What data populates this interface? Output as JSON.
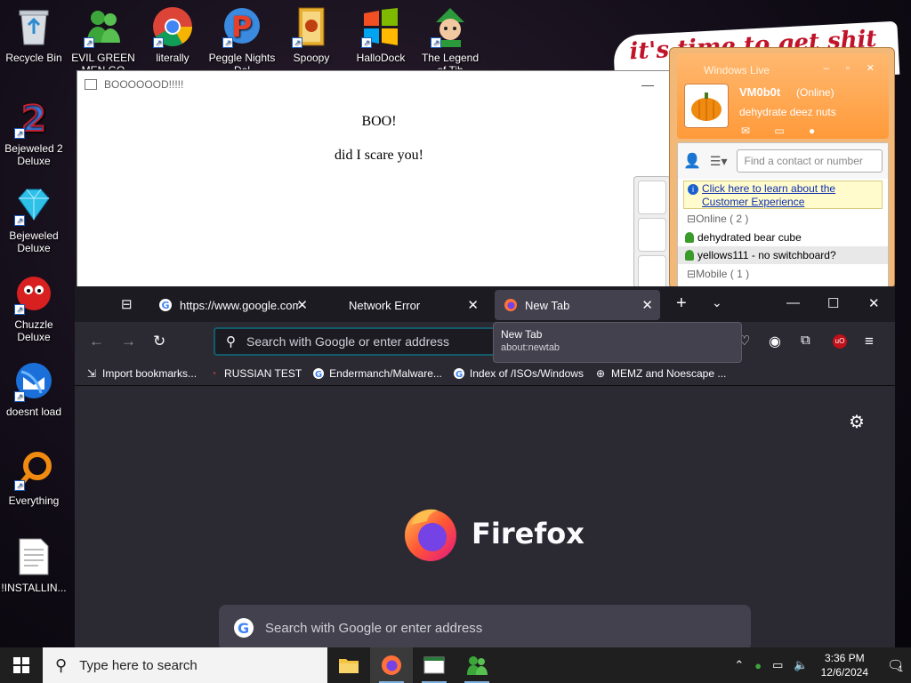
{
  "desktop": {
    "graffiti": "it's time to get shit",
    "icons": [
      {
        "label": "Recycle Bin",
        "icon": "recycle-bin-icon"
      },
      {
        "label": "EVIL GREEN MEN GO",
        "icon": "messenger-people-icon"
      },
      {
        "label": "literally",
        "icon": "chrome-icon"
      },
      {
        "label": "Peggle Nights Del",
        "icon": "peggle-icon"
      },
      {
        "label": "Spoopy",
        "icon": "spoopy-icon"
      },
      {
        "label": "HalloDock",
        "icon": "windows-logo-icon"
      },
      {
        "label": "The Legend of Tib",
        "icon": "legend-character-icon"
      },
      {
        "label": "Bejeweled 2 Deluxe",
        "icon": "bejeweled2-icon"
      },
      {
        "label": "Bejeweled Deluxe",
        "icon": "diamond-icon"
      },
      {
        "label": "Chuzzle Deluxe",
        "icon": "chuzzle-icon"
      },
      {
        "label": "doesnt load",
        "icon": "thunderbird-icon"
      },
      {
        "label": "Everything",
        "icon": "everything-search-icon"
      },
      {
        "label": "!INSTALLIN...",
        "icon": "text-file-icon"
      }
    ]
  },
  "boo_window": {
    "title": "BOOOOOOD!!!!!",
    "heading": "BOO!",
    "body": "did I scare you!"
  },
  "messenger": {
    "title": "Windows Live",
    "name": "VM0b0t",
    "status": "(Online)",
    "personal_message": "dehydrate deez nuts",
    "find_placeholder": "Find a contact or number",
    "info_link": "Click here to learn about the Customer Experience",
    "groups": [
      {
        "label": "Online ( 2 )",
        "contacts": [
          "dehydrated bear cube",
          "yellows111 - no switchboard?"
        ]
      },
      {
        "label": "Mobile ( 1 )",
        "contacts": []
      }
    ]
  },
  "firefox": {
    "tabs": [
      {
        "title": "https://www.google.com",
        "active": false
      },
      {
        "title": "Network Error",
        "active": false
      },
      {
        "title": "New Tab",
        "active": true
      }
    ],
    "url_placeholder": "Search with Google or enter address",
    "tooltip": {
      "title": "New Tab",
      "url": "about:newtab"
    },
    "bookmarks": [
      {
        "label": "Import bookmarks...",
        "icon": "import-icon"
      },
      {
        "label": "RUSSIAN TEST",
        "icon": "search-q-icon"
      },
      {
        "label": "Endermanch/Malware...",
        "icon": "google-icon"
      },
      {
        "label": "Index of /ISOs/Windows",
        "icon": "google-icon"
      },
      {
        "label": "MEMZ and Noescape ...",
        "icon": "globe-icon"
      }
    ],
    "brand": "Firefox",
    "search_placeholder": "Search with Google or enter address",
    "accent": "#00ddff"
  },
  "taskbar": {
    "search_placeholder": "Type here to search",
    "time": "3:36 PM",
    "date": "12/6/2024",
    "notification_count": "1"
  }
}
